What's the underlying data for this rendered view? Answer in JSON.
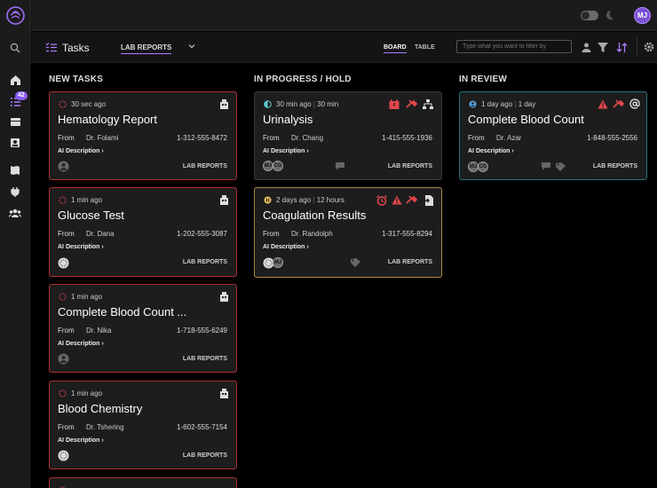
{
  "app": {
    "title": "Tasks",
    "user_initials": "MJ",
    "inbox_badge": "42"
  },
  "toolbar": {
    "view_select": "LAB REPORTS",
    "board_label": "BOARD",
    "table_label": "TABLE",
    "filter_placeholder": "Type what you want to filter by"
  },
  "columns": [
    {
      "title": "NEW TASKS"
    },
    {
      "title": "IN PROGRESS / HOLD"
    },
    {
      "title": "IN REVIEW"
    }
  ],
  "cards": [
    {
      "time": "30 sec ago",
      "title": "Hematology Report",
      "from_label": "From",
      "doctor": "Dr. Folami",
      "phone": "1-312-555-8472",
      "ai_label": "AI Description",
      "tag": "LAB REPORTS"
    },
    {
      "time": "1 min ago",
      "title": "Glucose Test",
      "from_label": "From",
      "doctor": "Dr. Dana",
      "phone": "1-202-555-3087",
      "ai_label": "AI Description",
      "tag": "LAB REPORTS"
    },
    {
      "time": "1 min ago",
      "title": "Complete Blood Count ...",
      "from_label": "From",
      "doctor": "Dr. Nika",
      "phone": "1-718-555-6249",
      "ai_label": "AI Description",
      "tag": "LAB REPORTS"
    },
    {
      "time": "1 min ago",
      "title": "Blood Chemistry",
      "from_label": "From",
      "doctor": "Dr. Tshering",
      "phone": "1-602-555-7154",
      "ai_label": "AI Description",
      "tag": "LAB REPORTS"
    },
    {
      "time": "30 min ago",
      "duration": "30 min",
      "title": "Urinalysis",
      "from_label": "From",
      "doctor": "Dr. Chang",
      "phone": "1-415-555-1936",
      "ai_label": "AI Description",
      "tag": "LAB REPORTS",
      "assignees": [
        "MJ",
        "CG"
      ]
    },
    {
      "time": "2 days ago",
      "duration": "12 hours",
      "title": "Coagulation Results",
      "from_label": "From",
      "doctor": "Dr. Randolph",
      "phone": "1-317-555-8294",
      "ai_label": "AI Description",
      "tag": "LAB REPORTS",
      "assignees": [
        "MJ"
      ]
    },
    {
      "time": "1 day ago",
      "duration": "1 day",
      "title": "Complete Blood Count",
      "from_label": "From",
      "doctor": "Dr. Azar",
      "phone": "1-848-555-2556",
      "ai_label": "AI Description",
      "tag": "LAB REPORTS",
      "assignees": [
        "MJ",
        "CG"
      ]
    }
  ],
  "colors": {
    "accent": "#8a5cf6",
    "new_border": "#a93030",
    "hold_border": "#b08a3a",
    "review_border": "#2f6f78",
    "alert": "#e0474c"
  }
}
